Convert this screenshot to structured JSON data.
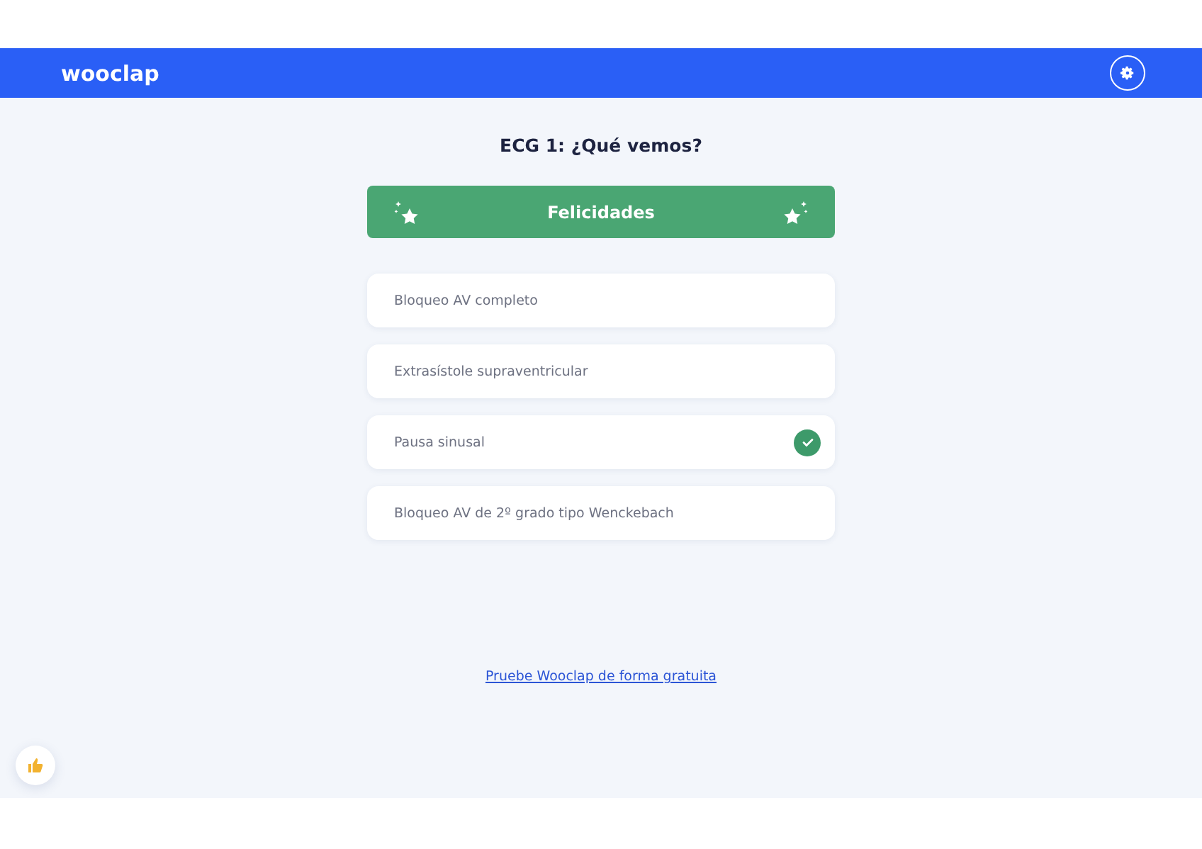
{
  "header": {
    "logo": "wooclap"
  },
  "question": {
    "title": "ECG 1: ¿Qué vemos?"
  },
  "banner": {
    "label": "Felicidades"
  },
  "options": [
    {
      "label": "Bloqueo AV completo",
      "correct": false
    },
    {
      "label": "Extrasístole supraventricular",
      "correct": false
    },
    {
      "label": "Pausa sinusal",
      "correct": true
    },
    {
      "label": "Bloqueo AV de 2º grado tipo Wenckebach",
      "correct": false
    }
  ],
  "footer_link": "Pruebe Wooclap de forma gratuita"
}
